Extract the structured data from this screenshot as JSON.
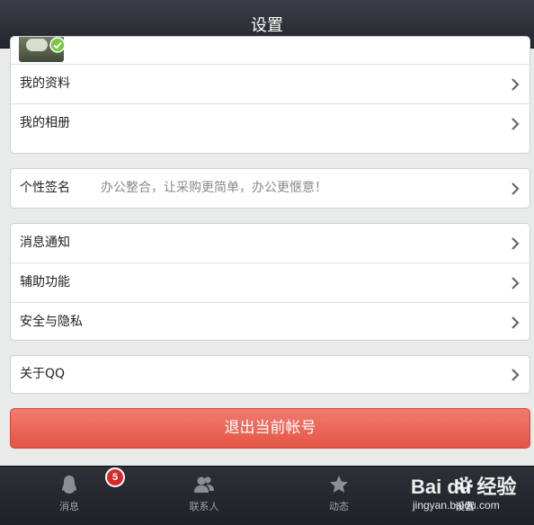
{
  "header": {
    "title": "设置"
  },
  "profile_group": {
    "items": [
      {
        "label": "我的资料"
      },
      {
        "label": "我的相册"
      }
    ]
  },
  "signature": {
    "label": "个性签名",
    "value": "办公整合，让采购更简单，办公更惬意！"
  },
  "settings_group": {
    "items": [
      {
        "label": "消息通知"
      },
      {
        "label": "辅助功能"
      },
      {
        "label": "安全与隐私"
      }
    ]
  },
  "about": {
    "label": "关于QQ"
  },
  "logout": {
    "label": "退出当前帐号"
  },
  "tabbar": {
    "tabs": [
      {
        "label": "消息",
        "icon": "penguin-icon",
        "badge": "5"
      },
      {
        "label": "联系人",
        "icon": "contacts-icon"
      },
      {
        "label": "动态",
        "icon": "star-icon"
      },
      {
        "label": "设置",
        "icon": "gear-icon"
      }
    ]
  },
  "watermark": {
    "brand": "Bai du 经验",
    "sub": "jingyan.baidu.com"
  },
  "colors": {
    "header_bg": "#2a2d33",
    "logout_button": "#e95e50",
    "badge": "#d42b2b",
    "background": "#e8ebe9"
  }
}
